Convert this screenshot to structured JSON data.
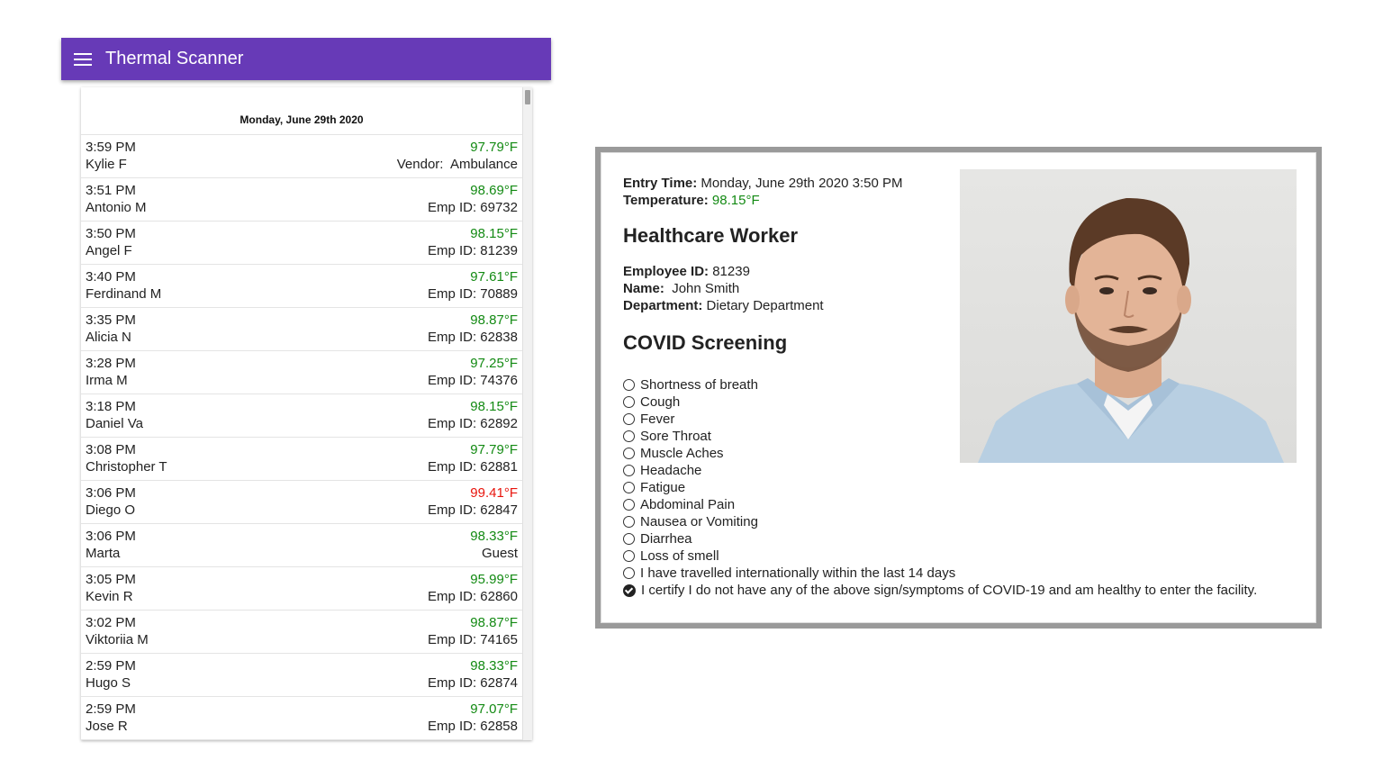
{
  "app": {
    "title": "Thermal Scanner"
  },
  "list": {
    "date": "Monday, June 29th 2020",
    "entries": [
      {
        "time": "3:59 PM",
        "name": "Kylie F",
        "temp": "97.79°F",
        "id": "Vendor:  Ambulance",
        "status": "normal"
      },
      {
        "time": "3:51 PM",
        "name": "Antonio M",
        "temp": "98.69°F",
        "id": "Emp ID: 69732",
        "status": "normal"
      },
      {
        "time": "3:50 PM",
        "name": "Angel F",
        "temp": "98.15°F",
        "id": "Emp ID: 81239",
        "status": "normal"
      },
      {
        "time": "3:40 PM",
        "name": "Ferdinand M",
        "temp": "97.61°F",
        "id": "Emp ID: 70889",
        "status": "normal"
      },
      {
        "time": "3:35 PM",
        "name": "Alicia N",
        "temp": "98.87°F",
        "id": "Emp ID: 62838",
        "status": "normal"
      },
      {
        "time": "3:28 PM",
        "name": "Irma M",
        "temp": "97.25°F",
        "id": "Emp ID: 74376",
        "status": "normal"
      },
      {
        "time": "3:18 PM",
        "name": "Daniel Va",
        "temp": "98.15°F",
        "id": "Emp ID: 62892",
        "status": "normal"
      },
      {
        "time": "3:08 PM",
        "name": "Christopher T",
        "temp": "97.79°F",
        "id": "Emp ID: 62881",
        "status": "normal"
      },
      {
        "time": "3:06 PM",
        "name": "Diego O",
        "temp": "99.41°F",
        "id": "Emp ID: 62847",
        "status": "high"
      },
      {
        "time": "3:06 PM",
        "name": "Marta",
        "temp": "98.33°F",
        "id": "Guest",
        "status": "normal"
      },
      {
        "time": "3:05 PM",
        "name": "Kevin R",
        "temp": "95.99°F",
        "id": "Emp ID: 62860",
        "status": "normal"
      },
      {
        "time": "3:02 PM",
        "name": "Viktoriia M",
        "temp": "98.87°F",
        "id": "Emp ID: 74165",
        "status": "normal"
      },
      {
        "time": "2:59 PM",
        "name": "Hugo S",
        "temp": "98.33°F",
        "id": "Emp ID: 62874",
        "status": "normal"
      },
      {
        "time": "2:59 PM",
        "name": "Jose R",
        "temp": "97.07°F",
        "id": "Emp ID: 62858",
        "status": "normal"
      }
    ]
  },
  "detail": {
    "entry_time_label": "Entry Time:",
    "entry_time": "Monday, June 29th 2020 3:50 PM",
    "temperature_label": "Temperature:",
    "temperature": "98.15°F",
    "role_heading": "Healthcare Worker",
    "employee_id_label": "Employee ID:",
    "employee_id": "81239",
    "name_label": "Name:",
    "name": "John Smith",
    "department_label": "Department:",
    "department": "Dietary Department",
    "screening_heading": "COVID Screening",
    "screening_items": [
      {
        "label": "Shortness of breath",
        "checked": false
      },
      {
        "label": "Cough",
        "checked": false
      },
      {
        "label": "Fever",
        "checked": false
      },
      {
        "label": "Sore Throat",
        "checked": false
      },
      {
        "label": "Muscle Aches",
        "checked": false
      },
      {
        "label": "Headache",
        "checked": false
      },
      {
        "label": "Fatigue",
        "checked": false
      },
      {
        "label": "Abdominal Pain",
        "checked": false
      },
      {
        "label": "Nausea or Vomiting",
        "checked": false
      },
      {
        "label": "Diarrhea",
        "checked": false
      },
      {
        "label": "Loss of smell",
        "checked": false
      },
      {
        "label": "I have travelled internationally within the last 14 days",
        "checked": false
      },
      {
        "label": "I certify I do not have any of the above sign/symptoms of COVID-19 and am healthy to enter the facility.",
        "checked": true
      }
    ]
  },
  "colors": {
    "appbar": "#673ab7",
    "temp_normal": "#138a13",
    "temp_high": "#e8140c"
  }
}
